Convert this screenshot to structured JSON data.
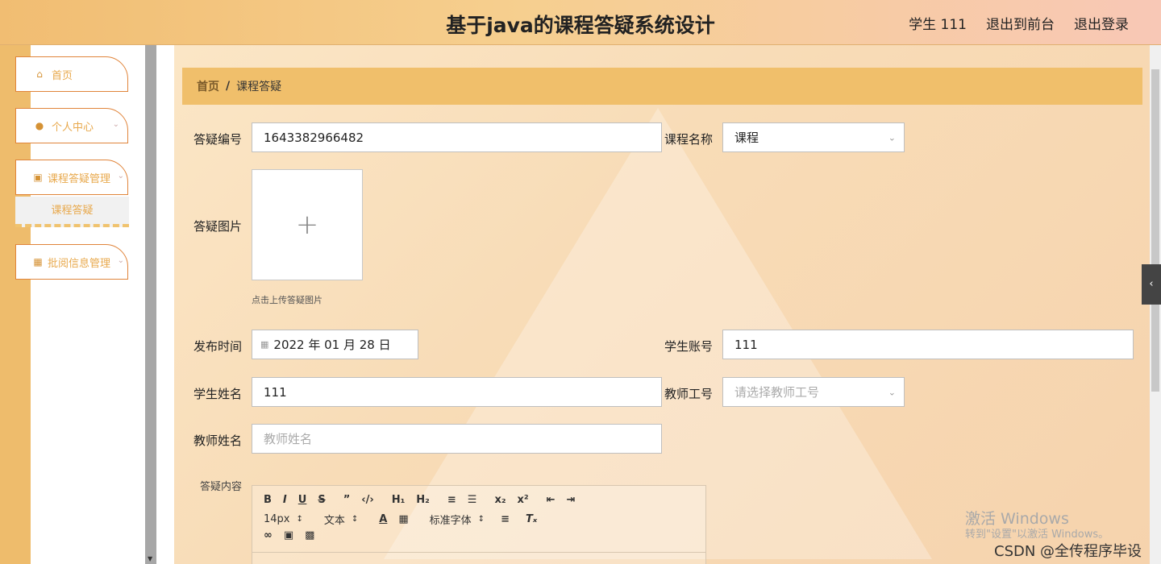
{
  "header": {
    "title": "基于java的课程答疑系统设计",
    "user": "学生 111",
    "back_front": "退出到前台",
    "logout": "退出登录"
  },
  "sidebar": {
    "items": [
      {
        "label": "首页",
        "icon": "home-icon"
      },
      {
        "label": "个人中心",
        "icon": "user-icon"
      },
      {
        "label": "课程答疑管理",
        "icon": "monitor-icon"
      },
      {
        "label": "批阅信息管理",
        "icon": "clipboard-icon"
      }
    ],
    "submenu": "课程答疑"
  },
  "breadcrumb": {
    "home": "首页",
    "separator": "/",
    "current": "课程答疑"
  },
  "form": {
    "id_label": "答疑编号",
    "id_value": "1643382966482",
    "course_label": "课程名称",
    "course_value": "课程",
    "image_label": "答疑图片",
    "upload_hint": "点击上传答疑图片",
    "time_label": "发布时间",
    "time_value": "2022 年 01 月 28 日",
    "student_account_label": "学生账号",
    "student_account_value": "111",
    "student_name_label": "学生姓名",
    "student_name_value": "111",
    "teacher_no_label": "教师工号",
    "teacher_no_placeholder": "请选择教师工号",
    "teacher_name_label": "教师姓名",
    "teacher_name_placeholder": "教师姓名",
    "content_label": "答疑内容"
  },
  "editor": {
    "font_size": "14px",
    "block": "文本",
    "font": "标准字体"
  },
  "watermark": {
    "line1": "激活 Windows",
    "line2": "转到\"设置\"以激活 Windows。",
    "csdn": "CSDN @全传程序毕设"
  }
}
